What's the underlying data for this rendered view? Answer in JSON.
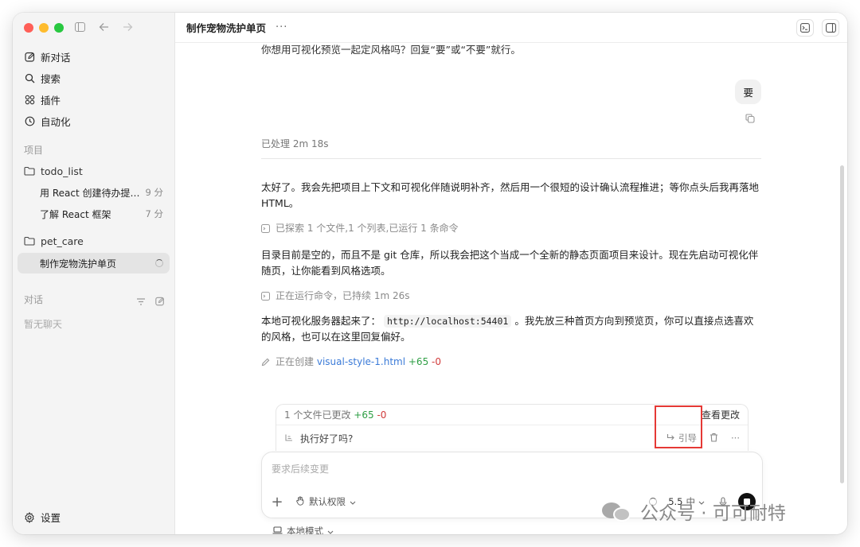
{
  "sidebar": {
    "nav": [
      {
        "label": "新对话",
        "icon": "edit-icon"
      },
      {
        "label": "搜索",
        "icon": "search-icon"
      },
      {
        "label": "插件",
        "icon": "grid-icon"
      },
      {
        "label": "自动化",
        "icon": "clock-icon"
      }
    ],
    "projects_label": "项目",
    "projects": [
      {
        "name": "todo_list",
        "threads": [
          {
            "title": "用 React 创建待办提醒应用",
            "time": "9 分"
          },
          {
            "title": "了解 React 框架",
            "time": "7 分"
          }
        ]
      },
      {
        "name": "pet_care",
        "threads": [
          {
            "title": "制作宠物洗护单页",
            "time": ""
          }
        ]
      }
    ],
    "conversations_label": "对话",
    "no_chats": "暂无聊天",
    "settings_label": "设置"
  },
  "header": {
    "title": "制作宠物洗护单页",
    "more": "···"
  },
  "chat": {
    "top_cut_text": "你想用可视化预览一起定风格吗？回复“要”或“不要”就行。",
    "user_reply": "要",
    "processed": "已处理 2m 18s",
    "p1": "太好了。我会先把项目上下文和可视化伴随说明补齐，然后用一个很短的设计确认流程推进；等你点头后我再落地 HTML。",
    "explored": "已探索 1 个文件,1 个列表,已运行 1 条命令",
    "p2": "目录目前是空的，而且不是 git 仓库，所以我会把这个当成一个全新的静态页面项目来设计。现在先启动可视化伴随页，让你能看到风格选项。",
    "running": "正在运行命令，已持续 1m 26s",
    "p3_before": "本地可视化服务器起来了：",
    "p3_code": "http://localhost:54401",
    "p3_after": "。我先放三种首页方向到预览页，你可以直接点选喜欢的风格，也可以在这里回复偏好。",
    "creating_prefix": "正在创建",
    "creating_file": "visual-style-1.html",
    "creating_plus": "+65",
    "creating_minus": "-0"
  },
  "changes": {
    "summary": "1 个文件已更改",
    "plus": "+65",
    "minus": "-0",
    "view_label": "查看更改",
    "queued_text": "执行好了吗?",
    "quote_label": "引导",
    "more": "···"
  },
  "composer": {
    "placeholder": "要求后续变更",
    "permission": "默认权限",
    "model": "5.5",
    "effort": "中",
    "local_mode": "本地模式"
  },
  "watermark": {
    "text": "公众号 · 可可耐特"
  }
}
